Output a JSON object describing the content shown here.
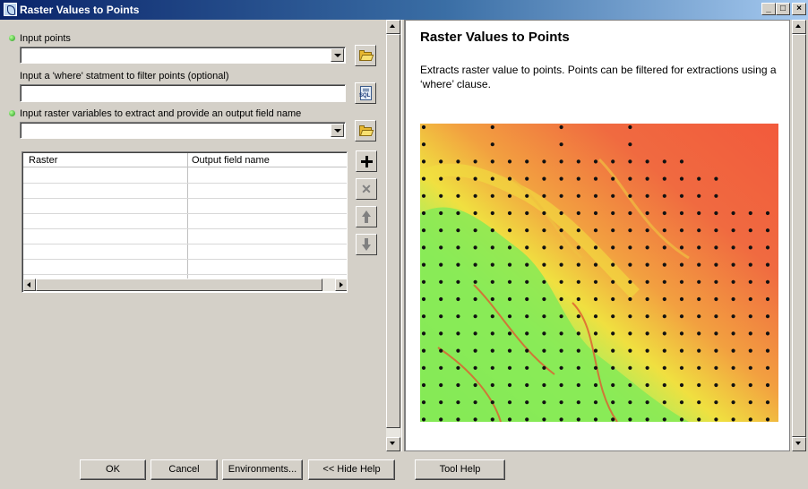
{
  "window": {
    "title": "Raster Values to Points",
    "controls": {
      "minimize": "_",
      "maximize": "□",
      "close": "×"
    }
  },
  "form": {
    "input_points": {
      "label": "Input points",
      "value": "",
      "required": true
    },
    "where_clause": {
      "label": "Input a 'where' statment to filter points (optional)",
      "value": "",
      "required": false,
      "sql_button": "SQL"
    },
    "raster_vars": {
      "label": "Input raster variables to extract and provide an output field name",
      "value": "",
      "required": true
    },
    "table": {
      "columns": [
        "Raster",
        "Output field name"
      ],
      "rows": []
    },
    "table_buttons": [
      "add-icon",
      "remove-icon",
      "move-up-icon",
      "move-down-icon"
    ],
    "remove_symbol": "✕"
  },
  "help": {
    "title": "Raster Values to Points",
    "description": "Extracts raster value to points. Points can be filtered for extractions using a ‘where’ clause."
  },
  "buttons": {
    "ok": "OK",
    "cancel": "Cancel",
    "environments": "Environments...",
    "hide_help": "<< Hide Help",
    "tool_help": "Tool Help"
  },
  "colors": {
    "required_dot": "#1f9a16",
    "title_bar_start": "#0a246a",
    "map_high": "#f05a3c",
    "map_mid": "#f0d040",
    "map_low": "#7ee85a",
    "point": "#111111"
  }
}
